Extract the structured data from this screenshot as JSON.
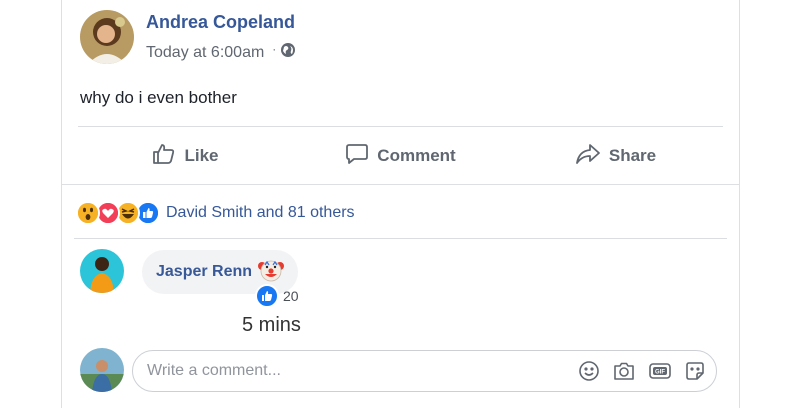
{
  "post": {
    "author": "Andrea Copeland",
    "timestamp": "Today at 6:00am",
    "separator": "·",
    "audience_icon": "globe-icon",
    "text": "why do i even bother"
  },
  "actions": {
    "like_label": "Like",
    "comment_label": "Comment",
    "share_label": "Share"
  },
  "reactions": {
    "emojis": [
      "wow-reaction-icon",
      "love-reaction-icon",
      "haha-reaction-icon",
      "like-reaction-icon"
    ],
    "summary": "David Smith and 81 others"
  },
  "comment": {
    "author": "Jasper Renn",
    "emoji_icon": "clown-face-icon",
    "like_count": "20",
    "time": "5 mins"
  },
  "composer": {
    "placeholder": "Write a comment...",
    "icons": [
      "emoji-icon",
      "camera-icon",
      "gif-icon",
      "sticker-icon"
    ]
  },
  "colors": {
    "link_blue": "#365899",
    "like_blue": "#1877f2",
    "love_red": "#f33e58",
    "reaction_yellow": "#f7b125",
    "muted_text": "#606770",
    "bubble_bg": "#f2f3f5"
  }
}
